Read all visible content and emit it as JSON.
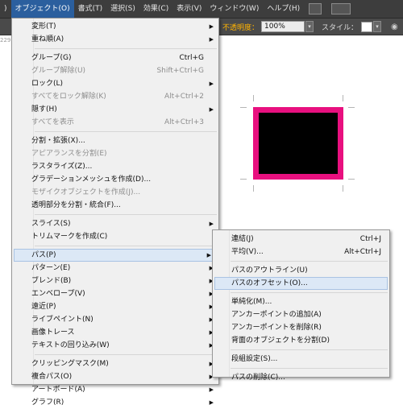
{
  "menubar": {
    "items": [
      ")",
      "オブジェクト(O)",
      "書式(T)",
      "選択(S)",
      "効果(C)",
      "表示(V)",
      "ウィンドウ(W)",
      "ヘルプ(H)"
    ]
  },
  "controlbar": {
    "opacity_label": "不透明度：",
    "opacity_value": "100%",
    "style_label": "スタイル：",
    "left_stub": "229"
  },
  "object_menu": {
    "items": [
      {
        "label": "変形(T)",
        "shortcut": "",
        "submenu": true,
        "disabled": false
      },
      {
        "label": "重ね順(A)",
        "shortcut": "",
        "submenu": true,
        "disabled": false
      },
      {
        "label": "グループ(G)",
        "shortcut": "Ctrl+G",
        "submenu": false,
        "disabled": false
      },
      {
        "label": "グループ解除(U)",
        "shortcut": "Shift+Ctrl+G",
        "submenu": false,
        "disabled": true
      },
      {
        "label": "ロック(L)",
        "shortcut": "",
        "submenu": true,
        "disabled": false
      },
      {
        "label": "すべてをロック解除(K)",
        "shortcut": "Alt+Ctrl+2",
        "submenu": false,
        "disabled": true
      },
      {
        "label": "隠す(H)",
        "shortcut": "",
        "submenu": true,
        "disabled": false
      },
      {
        "label": "すべてを表示",
        "shortcut": "Alt+Ctrl+3",
        "submenu": false,
        "disabled": true
      },
      {
        "label": "分割・拡張(X)...",
        "shortcut": "",
        "submenu": false,
        "disabled": false
      },
      {
        "label": "アピアランスを分割(E)",
        "shortcut": "",
        "submenu": false,
        "disabled": true
      },
      {
        "label": "ラスタライズ(Z)...",
        "shortcut": "",
        "submenu": false,
        "disabled": false
      },
      {
        "label": "グラデーションメッシュを作成(D)...",
        "shortcut": "",
        "submenu": false,
        "disabled": false
      },
      {
        "label": "モザイクオブジェクトを作成(J)...",
        "shortcut": "",
        "submenu": false,
        "disabled": true
      },
      {
        "label": "透明部分を分割・統合(F)...",
        "shortcut": "",
        "submenu": false,
        "disabled": false
      },
      {
        "label": "スライス(S)",
        "shortcut": "",
        "submenu": true,
        "disabled": false
      },
      {
        "label": "トリムマークを作成(C)",
        "shortcut": "",
        "submenu": false,
        "disabled": false
      },
      {
        "label": "パス(P)",
        "shortcut": "",
        "submenu": true,
        "disabled": false
      },
      {
        "label": "パターン(E)",
        "shortcut": "",
        "submenu": true,
        "disabled": false
      },
      {
        "label": "ブレンド(B)",
        "shortcut": "",
        "submenu": true,
        "disabled": false
      },
      {
        "label": "エンベロープ(V)",
        "shortcut": "",
        "submenu": true,
        "disabled": false
      },
      {
        "label": "遠近(P)",
        "shortcut": "",
        "submenu": true,
        "disabled": false
      },
      {
        "label": "ライブペイント(N)",
        "shortcut": "",
        "submenu": true,
        "disabled": false
      },
      {
        "label": "画像トレース",
        "shortcut": "",
        "submenu": true,
        "disabled": false
      },
      {
        "label": "テキストの回り込み(W)",
        "shortcut": "",
        "submenu": true,
        "disabled": false
      },
      {
        "label": "クリッピングマスク(M)",
        "shortcut": "",
        "submenu": true,
        "disabled": false
      },
      {
        "label": "複合パス(O)",
        "shortcut": "",
        "submenu": true,
        "disabled": false
      },
      {
        "label": "アートボード(A)",
        "shortcut": "",
        "submenu": true,
        "disabled": false
      },
      {
        "label": "グラフ(R)",
        "shortcut": "",
        "submenu": true,
        "disabled": false
      }
    ]
  },
  "path_submenu": {
    "items": [
      {
        "label": "連結(J)",
        "shortcut": "Ctrl+J"
      },
      {
        "label": "平均(V)...",
        "shortcut": "Alt+Ctrl+J"
      },
      {
        "label": "パスのアウトライン(U)",
        "shortcut": ""
      },
      {
        "label": "パスのオフセット(O)...",
        "shortcut": ""
      },
      {
        "label": "単純化(M)...",
        "shortcut": ""
      },
      {
        "label": "アンカーポイントの追加(A)",
        "shortcut": ""
      },
      {
        "label": "アンカーポイントを削除(R)",
        "shortcut": ""
      },
      {
        "label": "背面のオブジェクトを分割(D)",
        "shortcut": ""
      },
      {
        "label": "段組設定(S)...",
        "shortcut": ""
      },
      {
        "label": "パスの削除(C)...",
        "shortcut": ""
      }
    ]
  },
  "colors": {
    "artwork_stroke": "#e8107f",
    "artwork_fill": "#000000",
    "menu_highlight": "#dce8f6"
  }
}
